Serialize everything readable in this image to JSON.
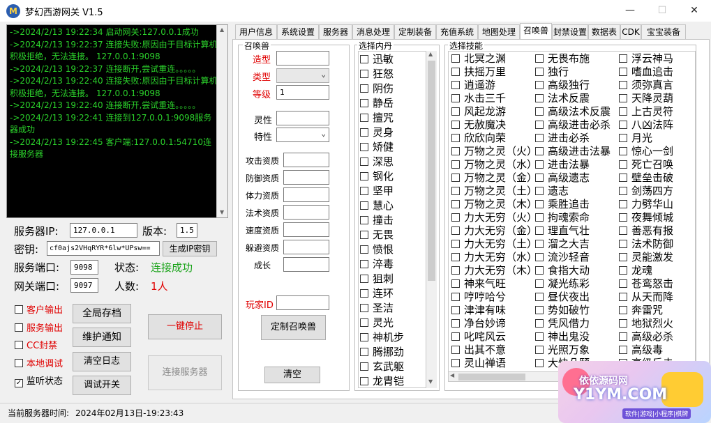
{
  "window": {
    "title": "梦幻西游网关 V1.5",
    "min": "—",
    "max": "☐",
    "close": "✕",
    "icon": "M"
  },
  "console": {
    "lines": [
      "->2024/2/13 19:22:34   启动网关:127.0.0.1成功",
      "->2024/2/13 19:22:37   连接失败:原因由于目标计算机积极拒绝，无法连接。 127.0.0.1:9098",
      "->2024/2/13 19:22:37   连接断开,尝试重连。。。。。",
      "->2024/2/13 19:22:40   连接失败:原因由于目标计算机积极拒绝，无法连接。 127.0.0.1:9098",
      "->2024/2/13 19:22:40   连接断开,尝试重连。。。。。",
      "->2024/2/13 19:22:41   连接到127.0.0.1:9098服务器成功",
      "->2024/2/13 19:22:45   客户端:127.0.0.1:54710连接服务器"
    ]
  },
  "server": {
    "ip_label": "服务器IP:",
    "ip_value": "127.0.0.1",
    "version_label": "版本:",
    "version_value": "1.5",
    "key_label": "密钥:",
    "key_value": "cf0ajs2VHqRYR*6lw*UPsw==",
    "gen_key_button": "生成IP密钥",
    "port_label": "服务端口:",
    "port_value": "9098",
    "status_label": "状态:",
    "status_value": "连接成功",
    "gw_port_label": "网关端口:",
    "gw_port_value": "9097",
    "count_label": "人数:",
    "count_value": "1人"
  },
  "options": [
    {
      "label": "客户输出",
      "checked": false
    },
    {
      "label": "服务输出",
      "checked": false
    },
    {
      "label": "CC封禁",
      "checked": false
    },
    {
      "label": "本地调试",
      "checked": false
    },
    {
      "label": "监听状态",
      "checked": true
    }
  ],
  "buttons": {
    "save_all": "全局存档",
    "maintenance": "维护通知",
    "clear_log": "清空日志",
    "debug": "调试开关",
    "stop": "一键停止",
    "connect": "连接服务器"
  },
  "tabs": [
    "用户信息",
    "系统设置",
    "服务器",
    "消息处理",
    "定制装备",
    "充值系统",
    "地图处理",
    "召唤兽",
    "封禁设置",
    "数据表",
    "CDK",
    "宝宝装备"
  ],
  "active_tab": "召唤兽",
  "summon": {
    "group_title": "召唤兽",
    "fields": {
      "model": "造型",
      "type": "类型",
      "level": "等级",
      "level_value": "1",
      "spirit": "灵性",
      "trait": "特性"
    },
    "aptitudes": [
      "攻击资质",
      "防御资质",
      "体力资质",
      "法术资质",
      "速度资质",
      "躲避资质",
      "成长"
    ],
    "player_id": "玩家ID",
    "customize_button": "定制召唤兽",
    "clear_button": "清空"
  },
  "inner_dan": {
    "title": "选择内丹",
    "items": [
      "迅敏",
      "狂怒",
      "阴伤",
      "静岳",
      "擅咒",
      "灵身",
      "矫健",
      "深思",
      "钢化",
      "坚甲",
      "慧心",
      "撞击",
      "无畏",
      "愤恨",
      "淬毒",
      "狙刺",
      "连环",
      "圣洁",
      "灵光",
      "神机步",
      "腾挪劲",
      "玄武躯",
      "龙胄铠"
    ]
  },
  "skills": {
    "title": "选择技能",
    "col1": [
      "北冥之渊",
      "扶摇万里",
      "逍遥游",
      "水击三千",
      "风起龙游",
      "无赦魔决",
      "欣欣向荣",
      "万物之灵（火）",
      "万物之灵（水）",
      "万物之灵（金）",
      "万物之灵（土）",
      "万物之灵（木）",
      "力大无穷（火）",
      "力大无穷（金）",
      "力大无穷（土）",
      "力大无穷（水）",
      "力大无穷（木）",
      "神来气旺",
      "哼哼哈兮",
      "津津有味",
      "净台妙谛",
      "叱咤风云",
      "出其不意",
      "灵山禅语"
    ],
    "col2": [
      "无畏布施",
      "独行",
      "高级独行",
      "法术反震",
      "高级法术反震",
      "高级进击必杀",
      "进击必杀",
      "高级进击法暴",
      "进击法暴",
      "高级遗志",
      "遗志",
      "乘胜追击",
      "拘魂索命",
      "理直气壮",
      "溜之大吉",
      "流沙轻音",
      "食指大动",
      "凝光练彩",
      "昼伏夜出",
      "势如破竹",
      "凭风借力",
      "神出鬼没",
      "光照万象",
      "大快朵颐"
    ],
    "col3": [
      "浮云神马",
      "嗜血追击",
      "须弥真言",
      "天降灵葫",
      "上古灵符",
      "八凶法阵",
      "月光",
      "惊心一剑",
      "死亡召唤",
      "壁垒击破",
      "剑荡四方",
      "力劈华山",
      "夜舞倾城",
      "善恶有报",
      "法术防御",
      "灵能激发",
      "龙魂",
      "苍鸾怒击",
      "从天而降",
      "奔雷咒",
      "地狱烈火",
      "高级必杀",
      "高级毒",
      "高级反击"
    ]
  },
  "statusbar": {
    "label": "当前服务器时间:",
    "time": "2024年02月13日-19:23:43"
  },
  "watermark": {
    "title": "依依源码网",
    "domain": "Y1YM.COM",
    "sub": "软件|游戏|小程序|棋牌"
  },
  "colors": {
    "log_green": "#2bd12b",
    "status_ok": "#1aa31a",
    "accent_red": "#e00000"
  }
}
